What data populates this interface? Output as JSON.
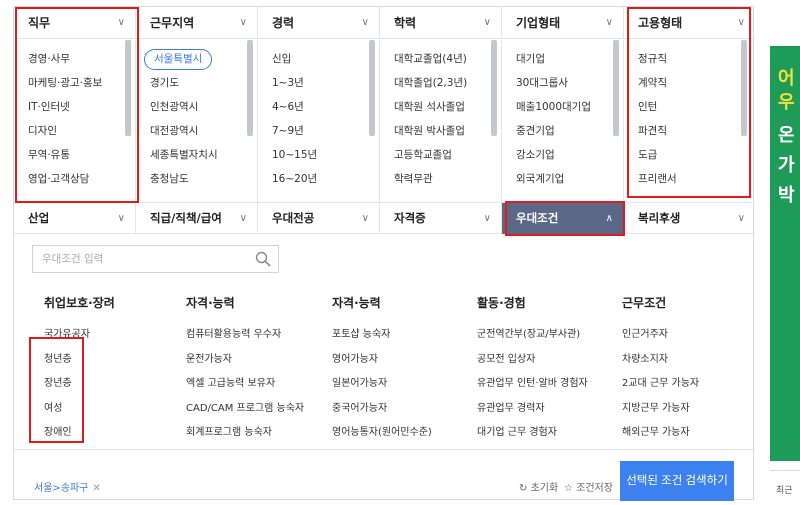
{
  "top_headers": [
    {
      "label": "직무"
    },
    {
      "label": "근무지역"
    },
    {
      "label": "경력"
    },
    {
      "label": "학력"
    },
    {
      "label": "기업형태"
    },
    {
      "label": "고용형태"
    }
  ],
  "lists": [
    {
      "items": [
        "경영·사무",
        "마케팅·광고·홍보",
        "IT·인터넷",
        "디자인",
        "무역·유통",
        "영업·고객상담"
      ]
    },
    {
      "items": [
        "서울특별시",
        "경기도",
        "인천광역시",
        "대전광역시",
        "세종특별자치시",
        "충청남도"
      ]
    },
    {
      "items": [
        "신입",
        "1~3년",
        "4~6년",
        "7~9년",
        "10~15년",
        "16~20년"
      ]
    },
    {
      "items": [
        "대학교졸업(4년)",
        "대학졸업(2,3년)",
        "대학원 석사졸업",
        "대학원 박사졸업",
        "고등학교졸업",
        "학력무관"
      ]
    },
    {
      "items": [
        "대기업",
        "30대그룹사",
        "매출1000대기업",
        "중견기업",
        "강소기업",
        "외국계기업"
      ]
    },
    {
      "items": [
        "정규직",
        "계약직",
        "인턴",
        "파견직",
        "도급",
        "프리랜서"
      ]
    }
  ],
  "second_headers": [
    {
      "label": "산업"
    },
    {
      "label": "직급/직책/급여"
    },
    {
      "label": "우대전공"
    },
    {
      "label": "자격증"
    },
    {
      "label": "우대조건"
    },
    {
      "label": "복리후생"
    }
  ],
  "search": {
    "placeholder": "우대조건 입력"
  },
  "benefit_columns": [
    {
      "title": "취업보호·장려",
      "items": [
        "국가유공자",
        "청년층",
        "장년층",
        "여성",
        "장애인"
      ]
    },
    {
      "title": "자격·능력",
      "items": [
        "컴퓨터활용능력 우수자",
        "운전가능자",
        "엑셀 고급능력 보유자",
        "CAD/CAM 프로그램 능숙자",
        "회계프로그램 능숙자"
      ]
    },
    {
      "title": "자격·능력",
      "items": [
        "포토샵 능숙자",
        "영어가능자",
        "일본어가능자",
        "중국어가능자",
        "영어능통자(원어민수준)"
      ]
    },
    {
      "title": "활동·경험",
      "items": [
        "군전역간부(장교/부사관)",
        "공모전 입상자",
        "유관업무 인턴·알바 경험자",
        "유관업무 경력자",
        "대기업 근무 경험자"
      ]
    },
    {
      "title": "근무조건",
      "items": [
        "인근거주자",
        "차량소지자",
        "2교대 근무 가능자",
        "지방근무 가능자",
        "해외근무 가능자"
      ]
    }
  ],
  "footer": {
    "selected_chip": "서울>송파구",
    "reset_label": "초기화",
    "save_label": "조건저장",
    "search_button": "선택된 조건 검색하기"
  },
  "ad": {
    "bottom_text": "최근"
  },
  "colors": {
    "accent": "#3d80f0",
    "active_tab": "#5a6787",
    "highlight": "#e21b1b",
    "chip": "#3c7ae4"
  }
}
